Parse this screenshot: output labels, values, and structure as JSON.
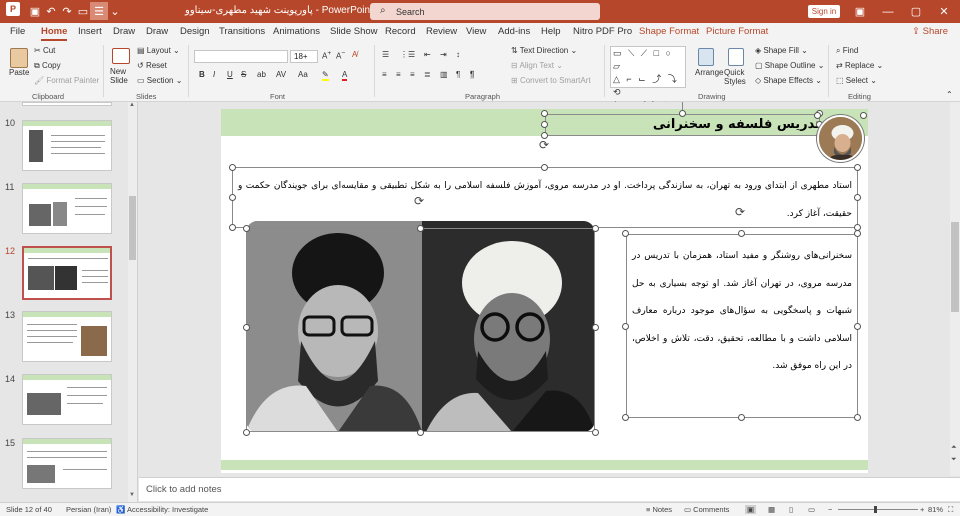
{
  "app": {
    "doc_title": "پاورپوینت شهید مطهری-سیناوو",
    "app_name": "PowerPoint",
    "title_full": "پاورپوینت شهید مطهری-سیناوو  -  PowerPoint",
    "search_placeholder": "Search",
    "sign_in": "Sign in",
    "share": "Share"
  },
  "menu": {
    "tabs": [
      "File",
      "Home",
      "Insert",
      "Draw",
      "Draw",
      "Design",
      "Transitions",
      "Animations",
      "Slide Show",
      "Record",
      "Review",
      "View",
      "Add-ins",
      "Help",
      "Nitro PDF Pro",
      "Shape Format",
      "Picture Format"
    ],
    "active": "Home"
  },
  "ribbon": {
    "clipboard": {
      "paste": "Paste",
      "cut": "Cut",
      "copy": "Copy",
      "format_painter": "Format Painter",
      "label": "Clipboard"
    },
    "slides": {
      "new_slide": "New Slide",
      "layout": "Layout",
      "reset": "Reset",
      "section": "Section",
      "label": "Slides"
    },
    "font": {
      "font_name": "",
      "font_size": "18+",
      "label": "Font",
      "buttons": [
        "B",
        "I",
        "U",
        "S",
        "ab",
        "AV",
        "Aa"
      ]
    },
    "paragraph": {
      "text_direction": "Text Direction",
      "align_text": "Align Text",
      "convert_smartart": "Convert to SmartArt",
      "label": "Paragraph"
    },
    "drawing": {
      "arrange": "Arrange",
      "quick_styles": "Quick Styles",
      "shape_fill": "Shape Fill",
      "shape_outline": "Shape Outline",
      "shape_effects": "Shape Effects",
      "label": "Drawing"
    },
    "editing": {
      "find": "Find",
      "replace": "Replace",
      "select": "Select",
      "label": "Editing"
    }
  },
  "thumbnails": {
    "numbers": [
      "10",
      "11",
      "12",
      "13",
      "14",
      "15"
    ],
    "selected": "12"
  },
  "slide": {
    "title": "تدریس فلسفه و سخنرانی",
    "body1": "استاد مطهری از ابتدای ورود به تهران، به سازندگی پرداخت. او در مدرسه مروی، آموزش فلسفه اسلامی را به شکل تطبیقی و مقایسه‌ای برای جویندگان حکمت و حقیقت، آغاز کرد.",
    "body2": "سخنرانی‌های روشنگر و مفید استاد، همزمان با تدریس در مدرسه مروی، در تهران آغاز شد. او توجه بسیاری به حل شبهات و پاسخگویی به سؤال‌های موجود درباره معارف اسلامی داشت و با مطالعه، تحقیق، دقت، تلاش و اخلاص، در این راه موفق شد."
  },
  "notes": {
    "placeholder": "Click to add notes"
  },
  "status": {
    "slide_info": "Slide 12 of 40",
    "language": "Persian (Iran)",
    "accessibility": "Accessibility: Investigate",
    "notes_btn": "Notes",
    "comments_btn": "Comments",
    "zoom": "81%"
  },
  "colors": {
    "accent": "#b7472a",
    "slide_band": "#c9e3b8"
  }
}
